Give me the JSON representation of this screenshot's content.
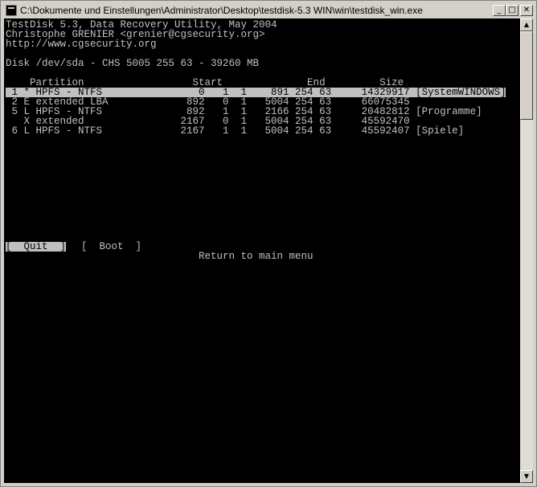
{
  "window": {
    "title": "C:\\Dokumente und Einstellungen\\Administrator\\Desktop\\testdisk-5.3 WIN\\win\\testdisk_win.exe",
    "minimize_glyph": "_",
    "maximize_glyph": "□",
    "close_glyph": "✕"
  },
  "header": {
    "line1": "TestDisk 5.3, Data Recovery Utility, May 2004",
    "line2": "Christophe GRENIER <grenier@cgsecurity.org>",
    "line3": "http://www.cgsecurity.org"
  },
  "disk": {
    "info": "Disk /dev/sda - CHS 5005 255 63 - 39260 MB"
  },
  "table": {
    "header": "    Partition                  Start              End         Size",
    "rows": [
      " 1 * HPFS - NTFS                0   1  1    891 254 63     14329917 [SystemWINDOWS]",
      " 2 E extended LBA             892   0  1   5004 254 63     66075345",
      " 5 L HPFS - NTFS              892   1  1   2166 254 63     20482812 [Programme]",
      "   X extended                2167   0  1   5004 254 63     45592470",
      " 6 L HPFS - NTFS             2167   1  1   5004 254 63     45592407 [Spiele]"
    ]
  },
  "menu": {
    "quit": "[  Quit  ]",
    "boot": "[  Boot  ]",
    "hint": "Return to main menu"
  },
  "scrollbar": {
    "up_glyph": "▲",
    "down_glyph": "▼"
  }
}
